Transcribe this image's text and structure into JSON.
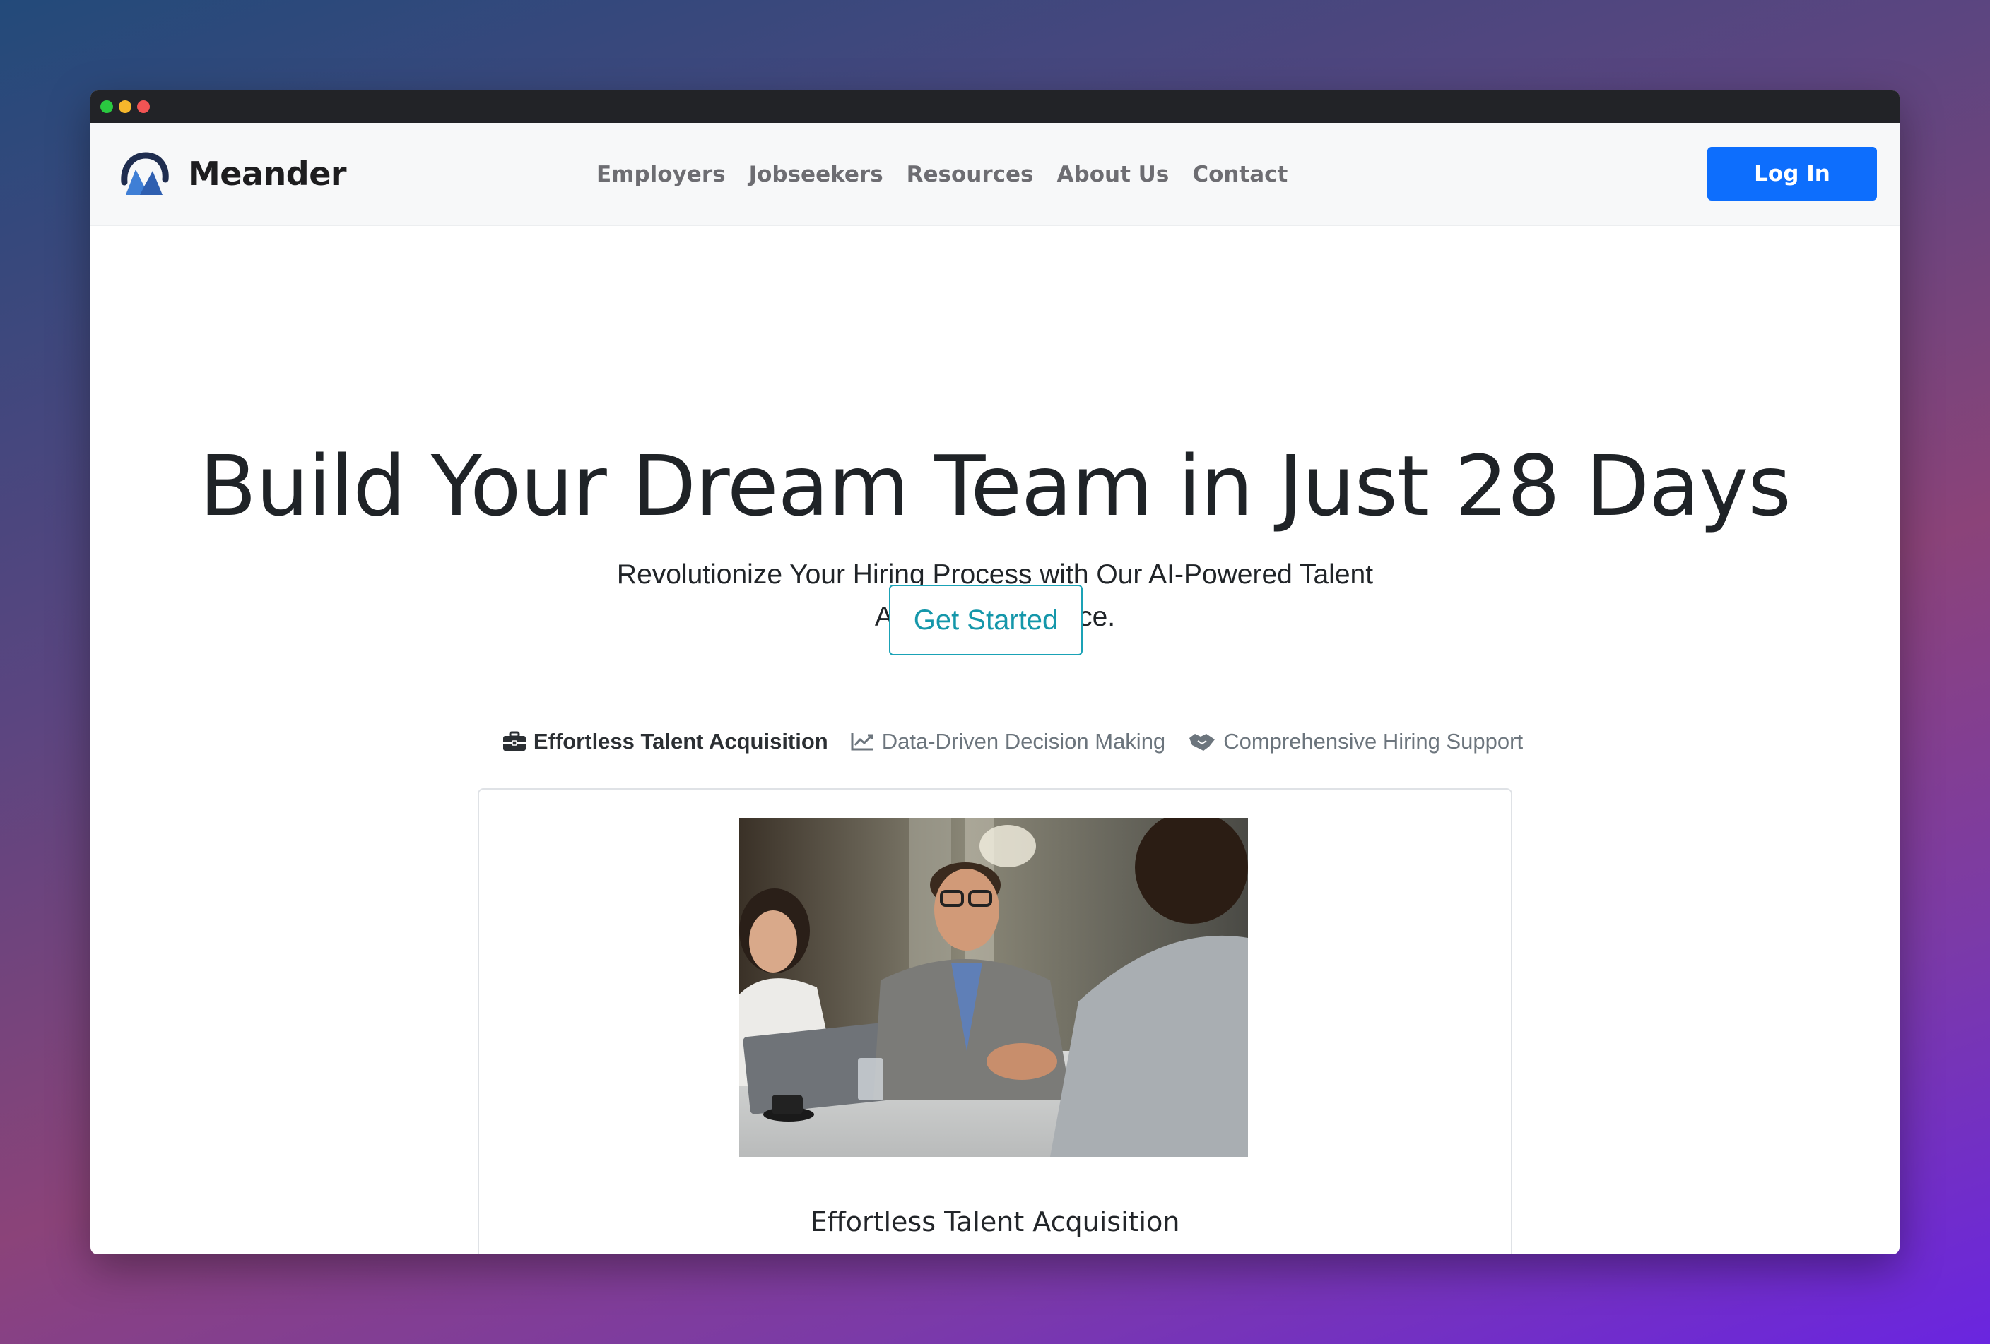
{
  "brand": {
    "name": "Meander"
  },
  "nav": {
    "links": [
      "Employers",
      "Jobseekers",
      "Resources",
      "About Us",
      "Contact"
    ],
    "login_label": "Log In"
  },
  "hero": {
    "title": "Build Your Dream Team in Just 28 Days",
    "subtitle": "Revolutionize Your Hiring Process with Our AI-Powered Talent Acquisition Service.",
    "cta_label": "Get Started"
  },
  "tabs": [
    {
      "label": "Effortless Talent Acquisition",
      "icon": "briefcase-icon",
      "active": true
    },
    {
      "label": "Data-Driven Decision Making",
      "icon": "chart-line-icon",
      "active": false
    },
    {
      "label": "Comprehensive Hiring Support",
      "icon": "handshake-icon",
      "active": false
    }
  ],
  "feature_card": {
    "title": "Effortless Talent Acquisition"
  },
  "colors": {
    "primary": "#0d6efd",
    "accent_teal": "#1597aa",
    "logo_blue": "#2f5fb0"
  }
}
